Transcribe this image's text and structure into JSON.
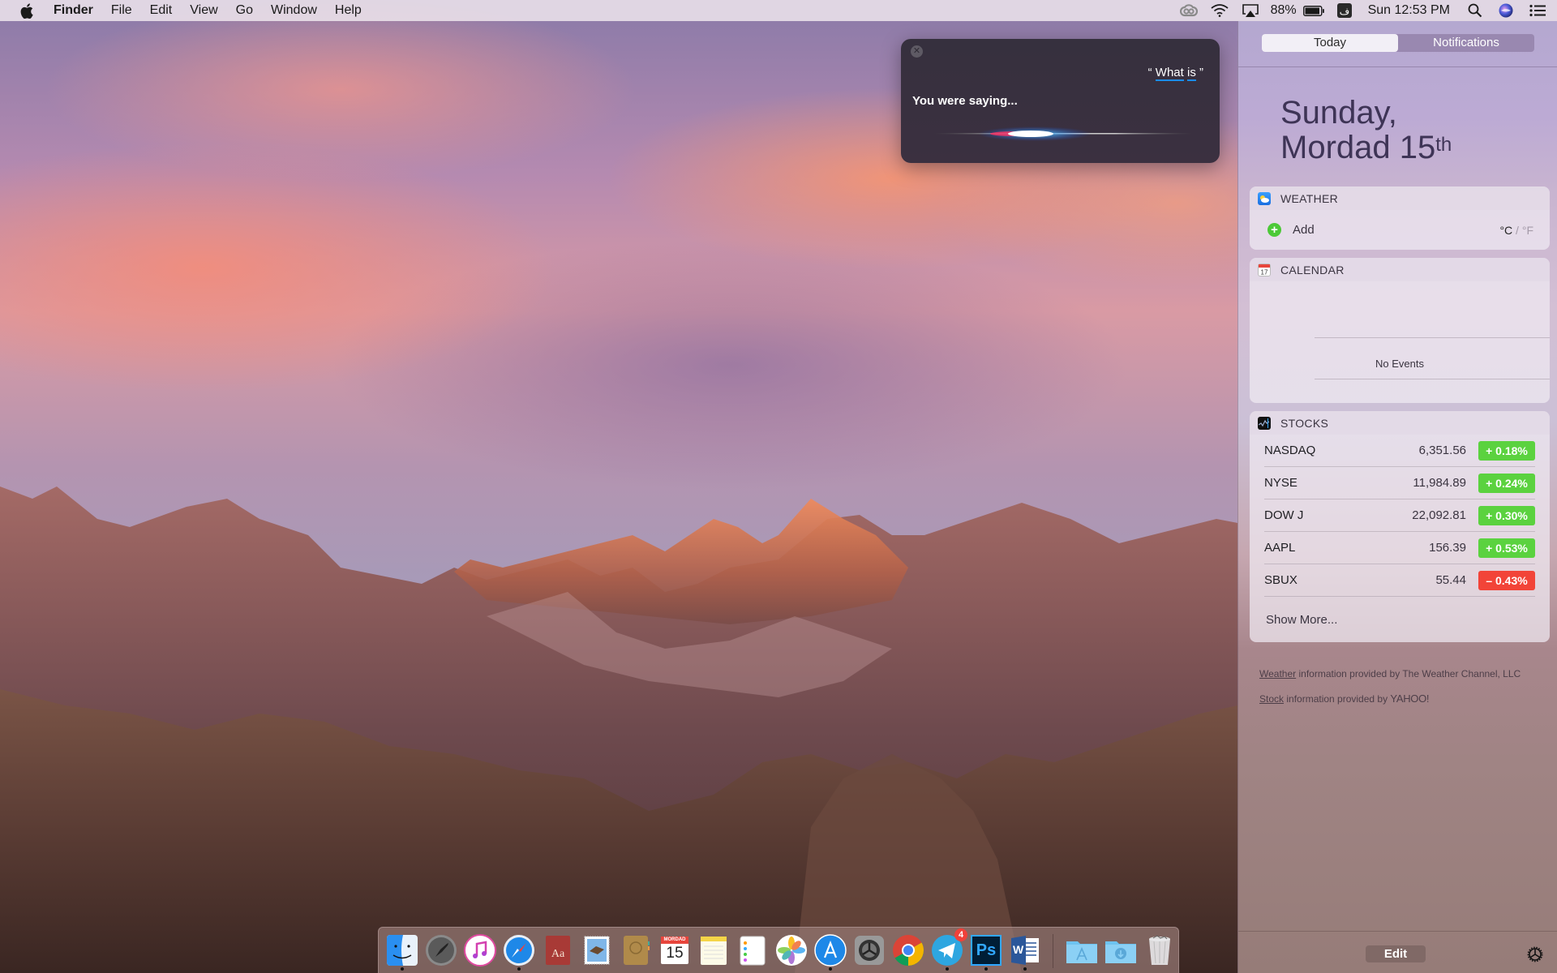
{
  "menubar": {
    "app_name": "Finder",
    "menus": [
      "File",
      "Edit",
      "View",
      "Go",
      "Window",
      "Help"
    ],
    "battery": "88%",
    "clock": "Sun 12:53 PM",
    "status_icons": [
      "creative-cloud-icon",
      "wifi-icon",
      "airplay-icon",
      "battery-icon",
      "input-source-icon",
      "spotlight-icon",
      "siri-icon",
      "notification-center-icon"
    ]
  },
  "siri": {
    "query_open": "“",
    "query_word1": "What",
    "query_word2": "is",
    "query_close": "”",
    "prompt": "You were saying..."
  },
  "notification_center": {
    "tabs": [
      {
        "label": "Today",
        "active": true
      },
      {
        "label": "Notifications",
        "active": false
      }
    ],
    "date_line1": "Sunday,",
    "date_line2": "Mordad 15",
    "date_suffix": "th",
    "weather": {
      "title": "WEATHER",
      "add_label": "Add",
      "unit_c": "°C",
      "unit_sep": " / ",
      "unit_f": "°F"
    },
    "calendar": {
      "title": "CALENDAR",
      "empty_label": "No Events"
    },
    "stocks": {
      "title": "STOCKS",
      "rows": [
        {
          "symbol": "NASDAQ",
          "price": "6,351.56",
          "change": "+ 0.18%",
          "direction": "up"
        },
        {
          "symbol": "NYSE",
          "price": "11,984.89",
          "change": "+ 0.24%",
          "direction": "up"
        },
        {
          "symbol": "DOW J",
          "price": "22,092.81",
          "change": "+ 0.30%",
          "direction": "up"
        },
        {
          "symbol": "AAPL",
          "price": "156.39",
          "change": "+ 0.53%",
          "direction": "up"
        },
        {
          "symbol": "SBUX",
          "price": "55.44",
          "change": "– 0.43%",
          "direction": "down"
        }
      ],
      "show_more": "Show More..."
    },
    "credits": {
      "weather_link": "Weather",
      "weather_text": " information provided by The Weather Channel, LLC",
      "stock_link": "Stock",
      "stock_text": " information provided by ",
      "stock_provider": "YAHOO!"
    },
    "edit_label": "Edit",
    "colors": {
      "up": "#5bd23f",
      "down": "#f24438"
    }
  },
  "dock": {
    "items": [
      {
        "name": "Finder",
        "icon": "finder-icon",
        "running": true
      },
      {
        "name": "Launchpad",
        "icon": "launchpad-icon",
        "running": false
      },
      {
        "name": "iTunes",
        "icon": "itunes-icon",
        "running": false
      },
      {
        "name": "Safari",
        "icon": "safari-icon",
        "running": true
      },
      {
        "name": "Dictionary",
        "icon": "dictionary-icon",
        "running": false
      },
      {
        "name": "Mail",
        "icon": "mail-icon",
        "running": false
      },
      {
        "name": "Contacts",
        "icon": "contacts-icon",
        "running": false
      },
      {
        "name": "Calendar",
        "icon": "calendar-icon",
        "running": false,
        "month": "MORDAD",
        "day": "15"
      },
      {
        "name": "Notes",
        "icon": "notes-icon",
        "running": false
      },
      {
        "name": "Reminders",
        "icon": "reminders-icon",
        "running": false
      },
      {
        "name": "Photos",
        "icon": "photos-icon",
        "running": false
      },
      {
        "name": "App Store",
        "icon": "app-store-icon",
        "running": true
      },
      {
        "name": "System Preferences",
        "icon": "system-preferences-icon",
        "running": false
      },
      {
        "name": "Google Chrome",
        "icon": "chrome-icon",
        "running": false
      },
      {
        "name": "Telegram",
        "icon": "telegram-icon",
        "running": true,
        "badge": "4"
      },
      {
        "name": "Photoshop",
        "icon": "photoshop-icon",
        "running": true,
        "label": "Ps"
      },
      {
        "name": "Word",
        "icon": "word-icon",
        "running": true,
        "label": "W"
      },
      {
        "name": "Applications",
        "icon": "applications-folder-icon",
        "running": false
      },
      {
        "name": "Downloads",
        "icon": "downloads-folder-icon",
        "running": false
      },
      {
        "name": "Trash",
        "icon": "trash-icon",
        "running": false
      }
    ]
  }
}
